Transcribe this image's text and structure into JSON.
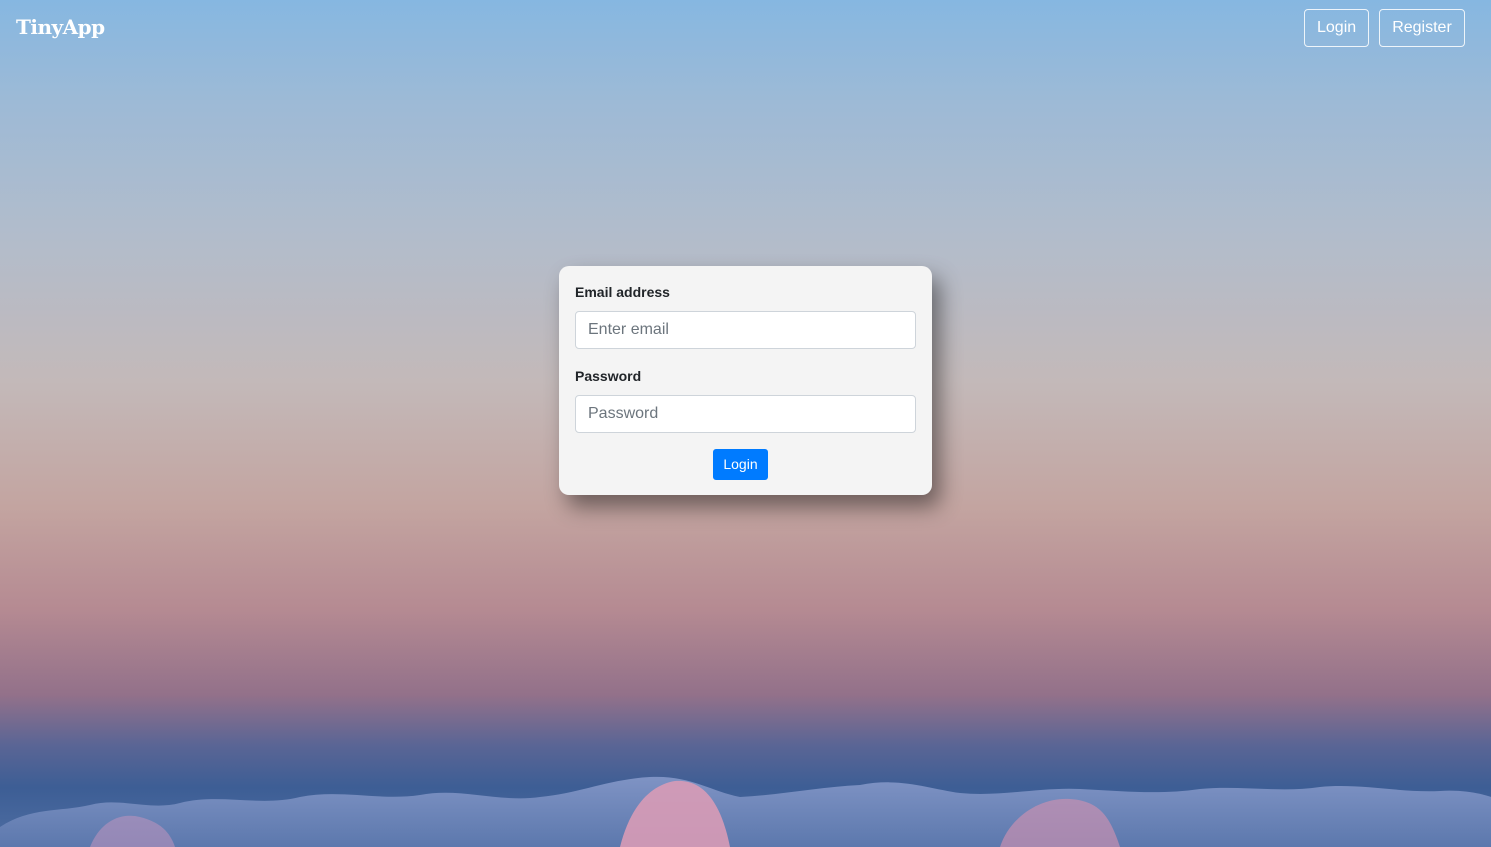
{
  "navbar": {
    "brand": "TinyApp",
    "login_label": "Login",
    "register_label": "Register"
  },
  "login_form": {
    "email_label": "Email address",
    "email_placeholder": "Enter email",
    "email_value": "",
    "password_label": "Password",
    "password_placeholder": "Password",
    "password_value": "",
    "submit_label": "Login"
  },
  "colors": {
    "primary": "#007bff",
    "card_background": "#f4f4f4",
    "nav_text": "#ffffff"
  }
}
